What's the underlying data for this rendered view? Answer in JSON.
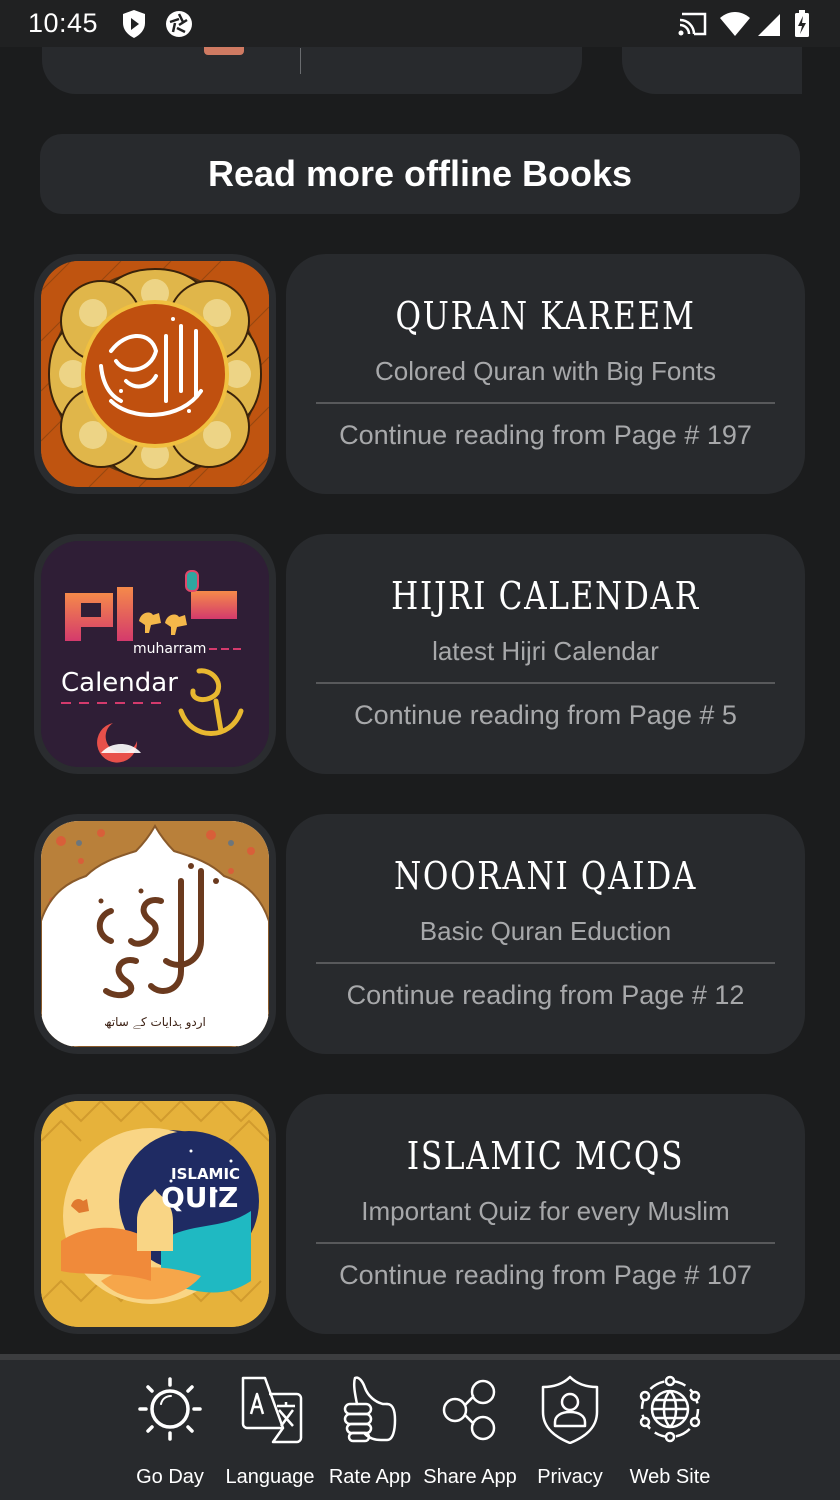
{
  "status_bar": {
    "time": "10:45",
    "left_icons": [
      "shield-play-icon",
      "aperture-icon"
    ],
    "right_icons": [
      "cast-icon",
      "wifi-icon",
      "signal-icon",
      "battery-charging-icon"
    ]
  },
  "read_more_button": {
    "label": "Read more offline Books"
  },
  "books": [
    {
      "title": "QURAN KAREEM",
      "subtitle": "Colored Quran with Big Fonts",
      "progress": "Continue reading from Page # 197",
      "page": 197,
      "thumbnail": "quran-kareem-thumbnail",
      "colors": {
        "bg": "#c4560f",
        "ring": "#e8c24a"
      }
    },
    {
      "title": "HIJRI CALENDAR",
      "subtitle": "latest Hijri Calendar",
      "progress": "Continue reading from Page # 5",
      "page": 5,
      "thumbnail": "hijri-calendar-thumbnail",
      "thumb_text": {
        "latin": "muharram",
        "label": "Calendar"
      },
      "colors": {
        "bg": "#2f1e36",
        "accent": "#f06a4f",
        "gold": "#e8b830"
      }
    },
    {
      "title": "NOORANI QAIDA",
      "subtitle": "Basic Quran Eduction",
      "progress": "Continue reading from Page # 12",
      "page": 12,
      "thumbnail": "noorani-qaida-thumbnail",
      "colors": {
        "bg": "#ffffff",
        "frame": "#b9803a",
        "ink": "#6b3a1e"
      }
    },
    {
      "title": "ISLAMIC MCQS",
      "subtitle": "Important Quiz for every Muslim",
      "progress": "Continue reading from Page # 107",
      "page": 107,
      "thumbnail": "islamic-quiz-thumbnail",
      "thumb_text": {
        "line1": "ISLAMIC",
        "line2": "QUIZ"
      },
      "colors": {
        "bg": "#e6b23b",
        "moon": "#f9d585",
        "sky": "#1f2b63",
        "teal": "#1fb9c2"
      }
    }
  ],
  "bottom_nav": [
    {
      "label": "Go Day",
      "icon": "sun-icon"
    },
    {
      "label": "Language",
      "icon": "translate-icon"
    },
    {
      "label": "Rate App",
      "icon": "thumbs-up-icon"
    },
    {
      "label": "Share App",
      "icon": "share-icon"
    },
    {
      "label": "Privacy",
      "icon": "privacy-shield-icon"
    },
    {
      "label": "Web Site",
      "icon": "globe-network-icon"
    }
  ],
  "theme": {
    "background": "#1b1c1d",
    "card": "#282a2d",
    "text_primary": "#ffffff",
    "text_secondary": "#a7a8aa"
  }
}
